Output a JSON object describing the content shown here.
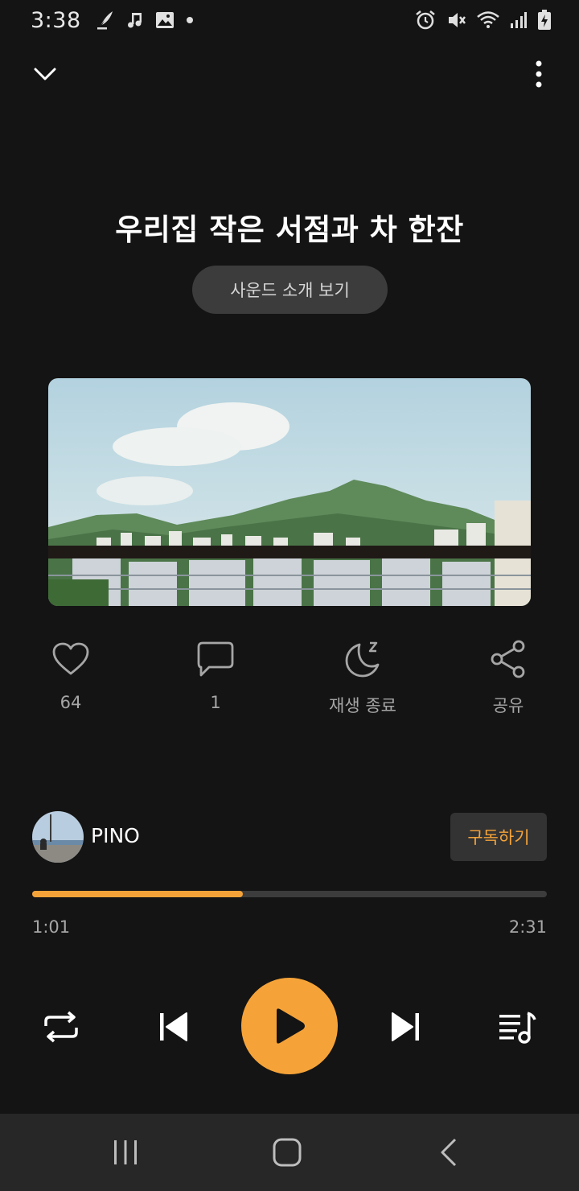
{
  "status_bar": {
    "time": "3:38",
    "left_icons": [
      "quill-notification-icon",
      "music-note-icon",
      "image-icon",
      "dot-icon"
    ],
    "right_icons": [
      "alarm-icon",
      "vibrate-off-icon",
      "wifi-icon",
      "signal-icon",
      "battery-charging-icon"
    ]
  },
  "player": {
    "title": "우리집 작은 서점과 차 한잔",
    "sound_intro_label": "사운드 소개 보기",
    "cover_image": "mountain-and-apartments-photo"
  },
  "actions": {
    "like_count": "64",
    "comment_count": "1",
    "sleep_timer_label": "재생 종료",
    "share_label": "공유"
  },
  "artist": {
    "name": "PINO",
    "subscribe_label": "구독하기"
  },
  "progress": {
    "current": "1:01",
    "total": "2:31",
    "fraction": 0.41
  },
  "colors": {
    "background": "#141414",
    "accent": "#f5a339",
    "secondary_text": "#a6a6a6",
    "nav_bar": "#272727"
  }
}
